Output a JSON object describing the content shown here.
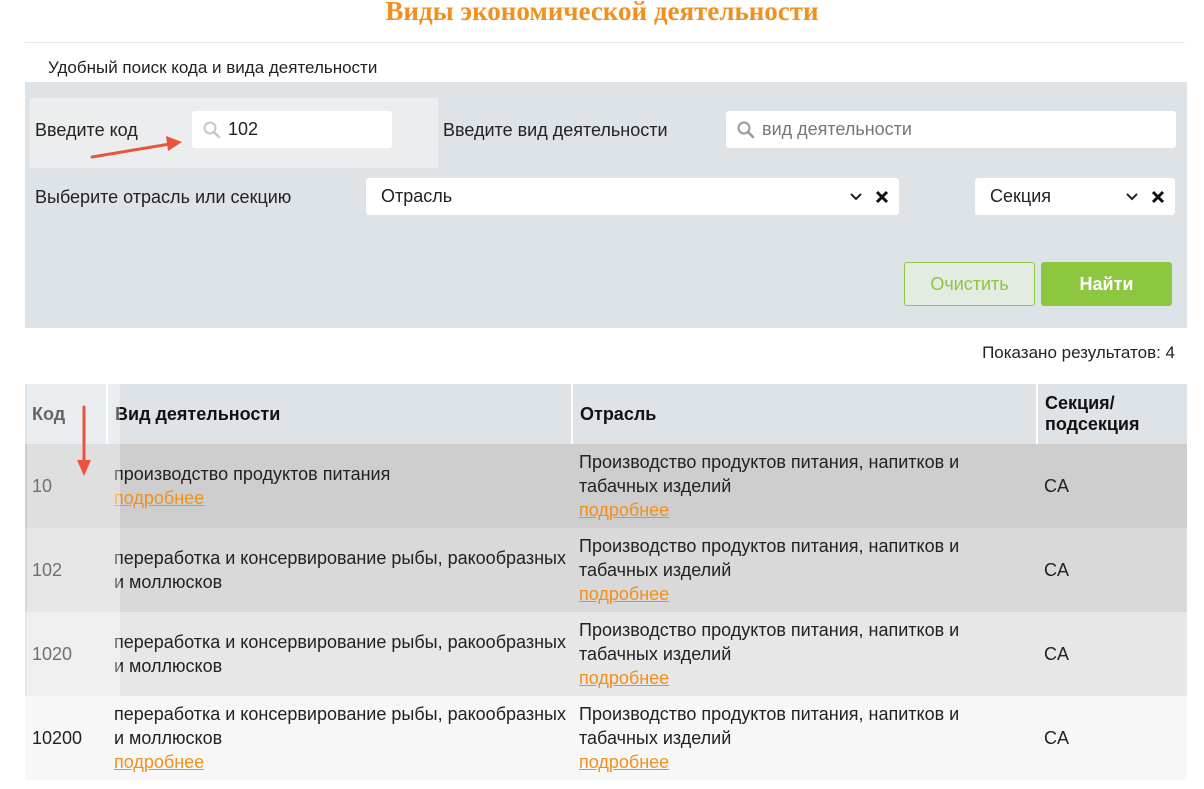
{
  "page": {
    "title": "Виды экономической деятельности",
    "subtitle": "Удобный поиск кода и вида деятельности"
  },
  "filters": {
    "code_label": "Введите код",
    "code_value": "102",
    "activity_label": "Введите вид деятельности",
    "activity_placeholder": "вид деятельности",
    "industry_label": "Выберите отрасль или секцию",
    "industry_select": "Отрасль",
    "section_select": "Секция",
    "clear_button": "Очистить",
    "find_button": "Найти"
  },
  "results": {
    "count_text": "Показано результатов: 4",
    "columns": [
      "Код",
      "Вид деятельности",
      "Отрасль",
      "Секция/ подсекция"
    ],
    "more_label": "подробнее",
    "rows": [
      {
        "code": "10",
        "activity": "производство продуктов питания",
        "activity_more": "подробнее",
        "industry": "Производство продуктов питания, напитков и табачных изделий",
        "industry_more": "подробнее",
        "section": "CA"
      },
      {
        "code": "102",
        "activity": "переработка и консервирование рыбы, ракообразных и моллюсков",
        "activity_more": "",
        "industry": "Производство продуктов питания, напитков и табачных изделий",
        "industry_more": "подробнее",
        "section": "CA"
      },
      {
        "code": "1020",
        "activity": "переработка и консервирование рыбы, ракообразных и моллюсков",
        "activity_more": "",
        "industry": "Производство продуктов питания, напитков и табачных изделий",
        "industry_more": "подробнее",
        "section": "CA"
      },
      {
        "code": "10200",
        "activity": "переработка и консервирование рыбы, ракообразных и моллюсков",
        "activity_more": "подробнее",
        "industry": "Производство продуктов питания, напитков и табачных изделий",
        "industry_more": "подробнее",
        "section": "CA"
      }
    ]
  },
  "icons": {
    "search": "search-icon",
    "chevron": "chevron-down-icon",
    "clear": "close-icon",
    "annotation_arrow": "arrow-icon"
  },
  "colors": {
    "title": "#f0901e",
    "accent_green": "#8dc63f",
    "panel": "#dde3e6",
    "link": "#f0901e",
    "annotation_arrow": "#e8553c"
  }
}
